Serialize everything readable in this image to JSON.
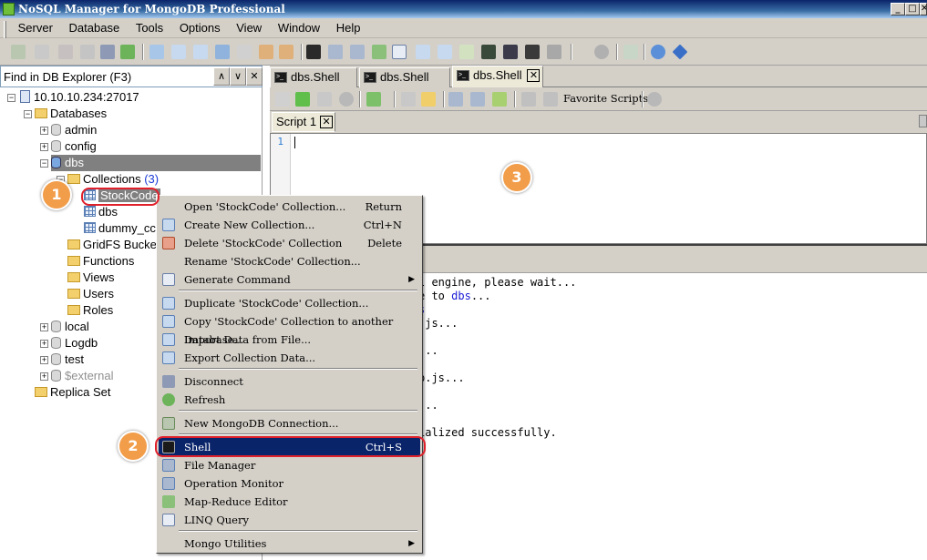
{
  "window": {
    "title": "NoSQL Manager for MongoDB Professional",
    "min_label": "_",
    "max_label": "□",
    "close_label": "✕"
  },
  "menu": [
    "Server",
    "Database",
    "Tools",
    "Options",
    "View",
    "Window",
    "Help"
  ],
  "find": {
    "placeholder": "Find in DB Explorer (F3)",
    "up": "∧",
    "down": "∨",
    "close": "✕"
  },
  "tree": {
    "server": "10.10.10.234:27017",
    "databases": "Databases",
    "admin": "admin",
    "config": "config",
    "dbs": "dbs",
    "collections": "Collections",
    "collections_count": "(3)",
    "stockcode": "StockCode",
    "dbs_coll": "dbs",
    "dummy": "dummy_cc",
    "gridfs": "GridFS Bucket",
    "functions": "Functions",
    "views": "Views",
    "users": "Users",
    "roles": "Roles",
    "local": "local",
    "logdb": "Logdb",
    "test": "test",
    "external": "$external",
    "replica": "Replica Set"
  },
  "tabs": [
    {
      "label": "dbs.Shell",
      "active": false
    },
    {
      "label": "dbs.Shell",
      "active": false
    },
    {
      "label": "dbs.Shell",
      "active": true
    }
  ],
  "shell_toolbar": {
    "favorite": "Favorite Scripts"
  },
  "script_tab": {
    "label": "Script 1",
    "close": "✕"
  },
  "editor": {
    "line_number": "1"
  },
  "output_lines": [
    {
      "text": "l engine, please wait...",
      "blue": ""
    },
    {
      "text": "e to ",
      "blue": "dbs",
      "after": "..."
    },
    {
      "text": "",
      "blue": "s"
    },
    {
      "text": ".js...",
      "blue": ""
    },
    {
      "text": "",
      "blue": ""
    },
    {
      "text": "...",
      "blue": ""
    },
    {
      "text": "",
      "blue": ""
    },
    {
      "text": "p.js...",
      "blue": ""
    },
    {
      "text": "",
      "blue": ""
    },
    {
      "text": "...",
      "blue": ""
    },
    {
      "text": "",
      "blue": ""
    },
    {
      "text": "ialized successfully.",
      "blue": ""
    }
  ],
  "context_menu": {
    "open": {
      "label": "Open 'StockCode' Collection...",
      "shortcut": "Return"
    },
    "create": {
      "label": "Create New Collection...",
      "shortcut": "Ctrl+N"
    },
    "delete": {
      "label": "Delete 'StockCode' Collection",
      "shortcut": "Delete"
    },
    "rename": {
      "label": "Rename 'StockCode' Collection..."
    },
    "generate": {
      "label": "Generate Command"
    },
    "duplicate": {
      "label": "Duplicate 'StockCode' Collection..."
    },
    "copy": {
      "label": "Copy 'StockCode' Collection to another Database..."
    },
    "import": {
      "label": "Import Data from File..."
    },
    "export": {
      "label": "Export Collection Data..."
    },
    "disconnect": {
      "label": "Disconnect"
    },
    "refresh": {
      "label": "Refresh"
    },
    "newconn": {
      "label": "New MongoDB Connection..."
    },
    "shell": {
      "label": "Shell",
      "shortcut": "Ctrl+S"
    },
    "filemgr": {
      "label": "File Manager"
    },
    "opmon": {
      "label": "Operation Monitor"
    },
    "mapreduce": {
      "label": "Map-Reduce Editor"
    },
    "linq": {
      "label": "LINQ Query"
    },
    "utilities": {
      "label": "Mongo Utilities"
    }
  },
  "badges": [
    "1",
    "2",
    "3"
  ]
}
